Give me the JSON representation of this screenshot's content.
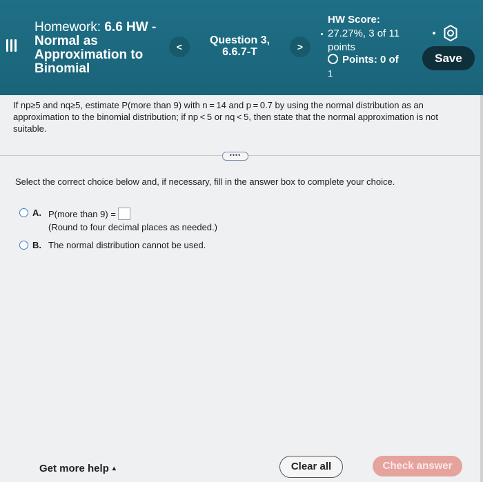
{
  "header": {
    "homework_prefix": "Homework: ",
    "homework_title": "6.6 HW - Normal as Approximation to Binomial",
    "prev_label": "<",
    "next_label": ">",
    "question_label": "Question 3, 6.6.7-T",
    "hw_score_title": "HW Score:",
    "hw_score_value": "27.27%, 3 of 11 points",
    "points_label": "Points: 0 of",
    "points_total": "1",
    "save_label": "Save",
    "settings_icon": "gear-icon",
    "menu_icon": "menu-icon"
  },
  "problem": {
    "text": "If np≥5 and nq≥5, estimate P(more than 9) with n = 14 and p = 0.7 by using the normal distribution as an approximation to the binomial distribution; if np < 5 or nq < 5, then state that the normal approximation is not suitable."
  },
  "more_button": "••••",
  "instruction": "Select the correct choice below and, if necessary, fill in the answer box to complete your choice.",
  "choices": [
    {
      "letter": "A.",
      "text": "P(more than 9) =",
      "note": "(Round to four decimal places as needed.)",
      "answer_value": ""
    },
    {
      "letter": "B.",
      "text": "The normal distribution cannot be used."
    }
  ],
  "footer": {
    "help_label": "Get more help",
    "help_caret": "▴",
    "clear_label": "Clear all",
    "check_label": "Check answer"
  },
  "colors": {
    "header_bg": "#1f6f86",
    "save_bg": "#0f2f3b",
    "check_bg": "#e6a39e",
    "radio_border": "#3a7ac8"
  }
}
